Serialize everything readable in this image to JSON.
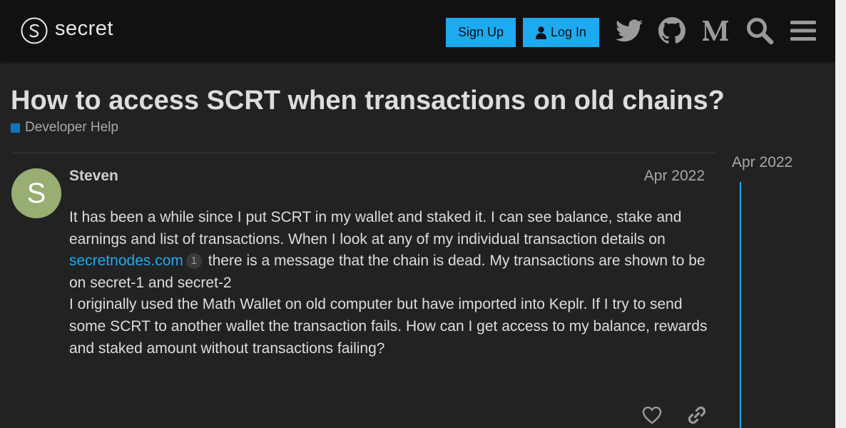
{
  "header": {
    "logo_text": "secret",
    "signup_label": "Sign Up",
    "login_label": "Log In",
    "icons": [
      "twitter-icon",
      "github-icon",
      "medium-icon",
      "search-icon",
      "menu-icon"
    ],
    "accent_color": "#1eaaf1"
  },
  "topic": {
    "title": "How to access SCRT when transactions on old chains?",
    "category": "Developer Help",
    "category_color": "#0e76bd"
  },
  "post": {
    "avatar_letter": "S",
    "avatar_color": "#98ae72",
    "username": "Steven",
    "date": "Apr 2022",
    "para1_before": "It has been a while since I put SCRT in my wallet and staked it. I can see balance, stake and earnings and list of transactions. When I look at any of my individual transaction details on ",
    "link_text": "secretnodes.com",
    "link_clicks": "1",
    "para1_after": " there is a message that the chain is dead. My transactions are shown to be on secret-1 and secret-2",
    "para2": "I originally used the Math Wallet on old computer but have imported into Keplr. If I try to send some SCRT to another wallet the transaction fails. How can I get access to my balance, rewards and staked amount without transactions failing?"
  },
  "timeline": {
    "start_date": "Apr 2022"
  }
}
